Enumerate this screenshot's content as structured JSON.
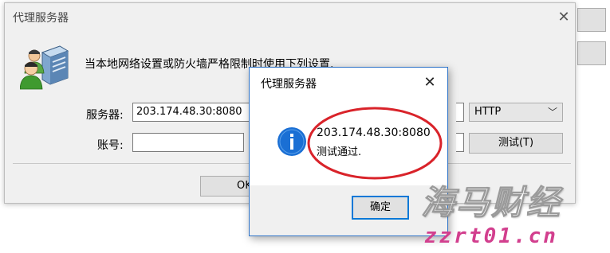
{
  "main_window": {
    "title": "代理服务器",
    "close_glyph": "✕",
    "description": "当本地网络设置或防火墙严格限制时使用下列设置.",
    "server_label": "服务器:",
    "server_value": "203.174.48.30:8080",
    "account_label": "账号:",
    "account_value": "",
    "protocol_value": "HTTP",
    "test_button_label": "测试(T)",
    "ok_button_label": "OK",
    "icon": "network-users-server-icon"
  },
  "info_dialog": {
    "title": "代理服务器",
    "close_glyph": "✕",
    "icon": "info-icon",
    "address": "203.174.48.30:8080",
    "message": "测试通过.",
    "ok_button_label": "确定"
  },
  "annotation": {
    "color": "#d9232a"
  },
  "watermark": {
    "text": "海马财经",
    "url": "zzrt01.cn"
  }
}
